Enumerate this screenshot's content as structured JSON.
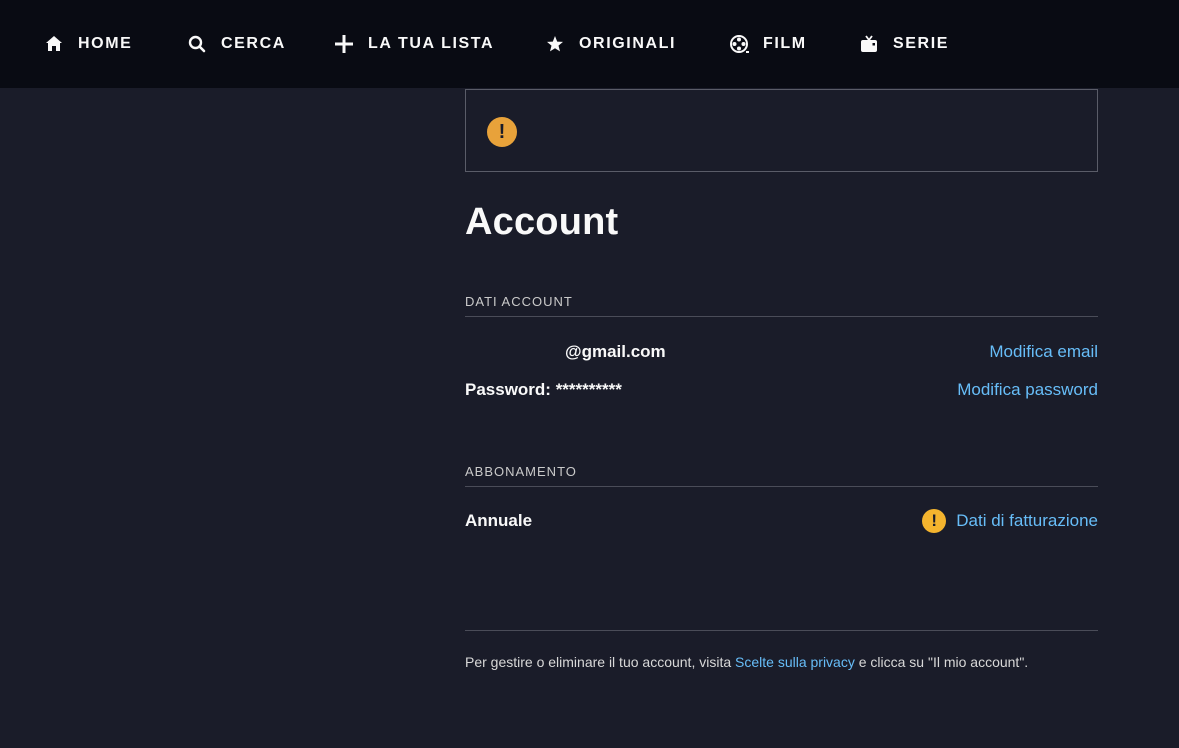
{
  "nav": {
    "items": [
      {
        "label": "HOME",
        "icon": "home-icon"
      },
      {
        "label": "CERCA",
        "icon": "search-icon"
      },
      {
        "label": "LA TUA LISTA",
        "icon": "plus-icon"
      },
      {
        "label": "ORIGINALI",
        "icon": "star-icon"
      },
      {
        "label": "FILM",
        "icon": "film-reel-icon"
      },
      {
        "label": "SERIE",
        "icon": "tv-icon"
      }
    ]
  },
  "alert": {
    "icon": "warning-icon",
    "symbol": "!"
  },
  "page": {
    "title": "Account"
  },
  "account_section": {
    "header": "DATI ACCOUNT",
    "email": "@gmail.com",
    "email_action": "Modifica email",
    "password": "Password: **********",
    "password_action": "Modifica password"
  },
  "subscription_section": {
    "header": "ABBONAMENTO",
    "plan": "Annuale",
    "billing_icon": "warning-icon",
    "billing_symbol": "!",
    "billing_action": "Dati di fatturazione"
  },
  "footer": {
    "text_before": "Per gestire o eliminare il tuo account, visita ",
    "link": "Scelte sulla privacy",
    "text_after": " e clicca su \"Il mio account\"."
  },
  "colors": {
    "background": "#1a1c29",
    "navbar": "#090b13",
    "link": "#67bdf8",
    "warning": "#e8a23a"
  }
}
